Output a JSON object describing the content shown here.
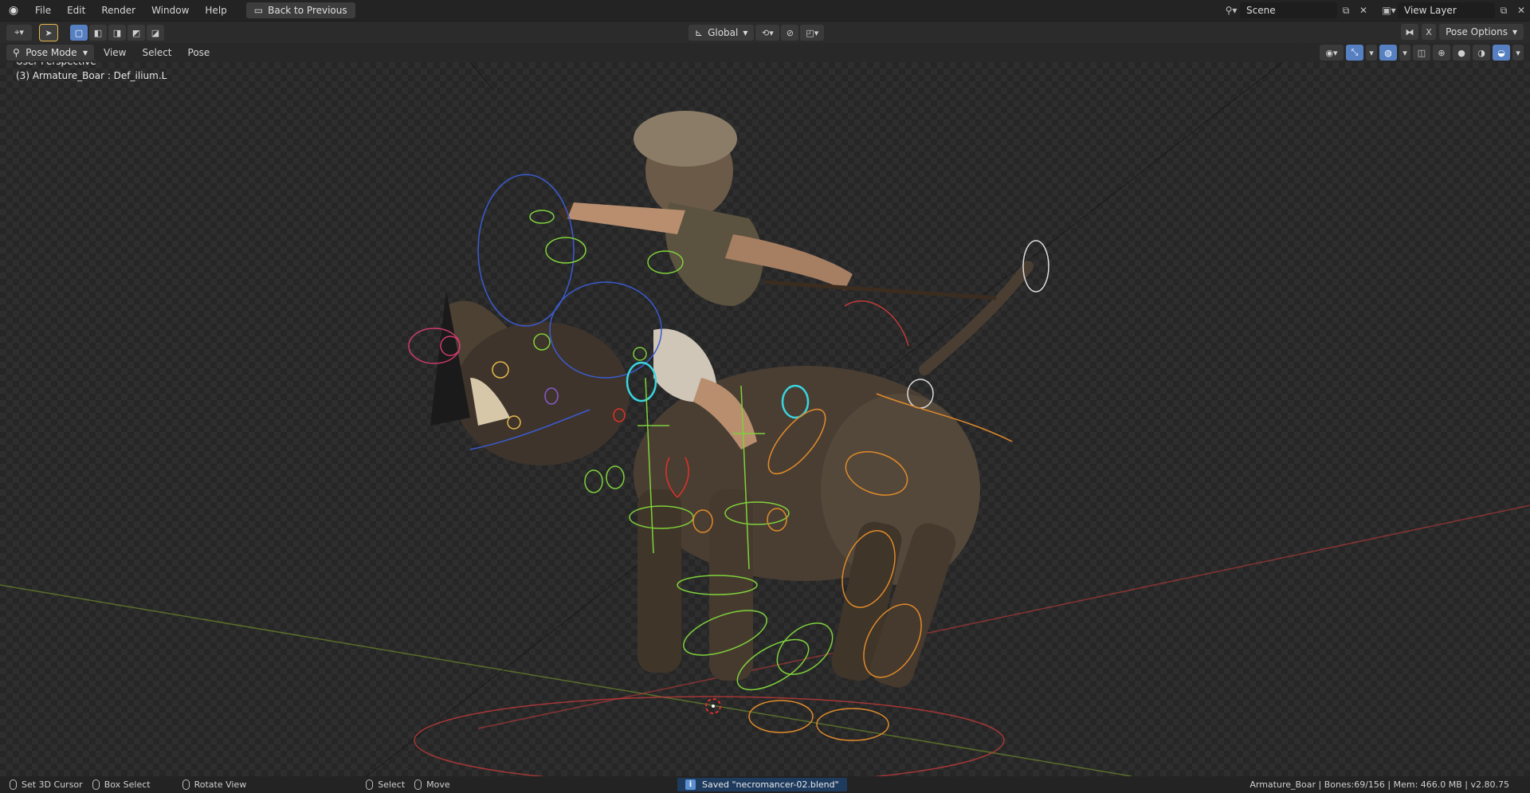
{
  "topbar": {
    "menus": [
      "File",
      "Edit",
      "Render",
      "Window",
      "Help"
    ],
    "back_label": "Back to Previous",
    "scene_name": "Scene",
    "view_layer": "View Layer"
  },
  "toolbar": {
    "orientation": "Global"
  },
  "header3d": {
    "mode": "Pose Mode",
    "menus": [
      "View",
      "Select",
      "Pose"
    ],
    "pose_options": "Pose Options",
    "axis_x": "X"
  },
  "viewport": {
    "perspective": "User Perspective",
    "active": "(3) Armature_Boar : Def_ilium.L"
  },
  "statusbar": {
    "set_cursor": "Set 3D Cursor",
    "box_select": "Box Select",
    "rotate_view": "Rotate View",
    "select": "Select",
    "move": "Move",
    "saved_msg": "Saved \"necromancer-02.blend\"",
    "stats": "Armature_Boar | Bones:69/156  |  Mem: 466.0 MB | v2.80.75"
  },
  "colors": {
    "accent": "#5680c2",
    "bone_green": "#7fd13b",
    "bone_orange": "#e08a2a",
    "bone_cyan": "#39d5e0",
    "axis_red": "#c43a3a",
    "axis_green": "#6c8a2a"
  }
}
